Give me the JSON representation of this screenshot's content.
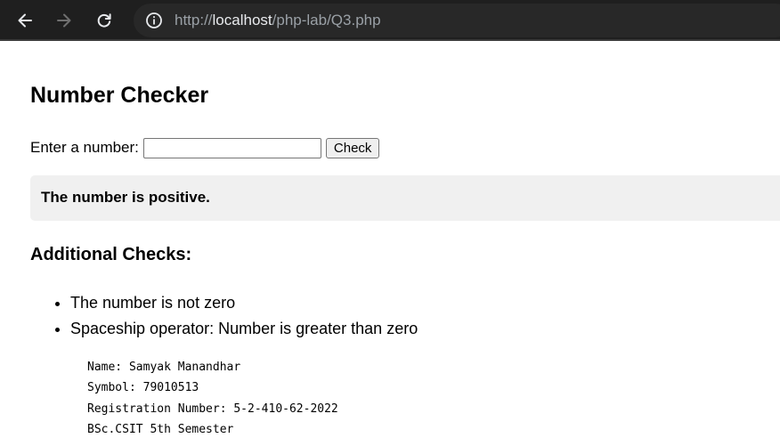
{
  "browser": {
    "url_scheme": "http://",
    "url_host": "localhost",
    "url_path": "/php-lab/Q3.php"
  },
  "page": {
    "title": "Number Checker",
    "form": {
      "label": "Enter a number:",
      "input_value": "",
      "button_label": "Check"
    },
    "result": "The number is positive.",
    "additional_heading": "Additional Checks:",
    "checks": [
      "The number is not zero",
      "Spaceship operator: Number is greater than zero"
    ],
    "student_info": [
      "Name: Samyak Manandhar",
      "Symbol: 79010513",
      "Registration Number: 5-2-410-62-2022",
      "BSc.CSIT 5th Semester"
    ]
  }
}
